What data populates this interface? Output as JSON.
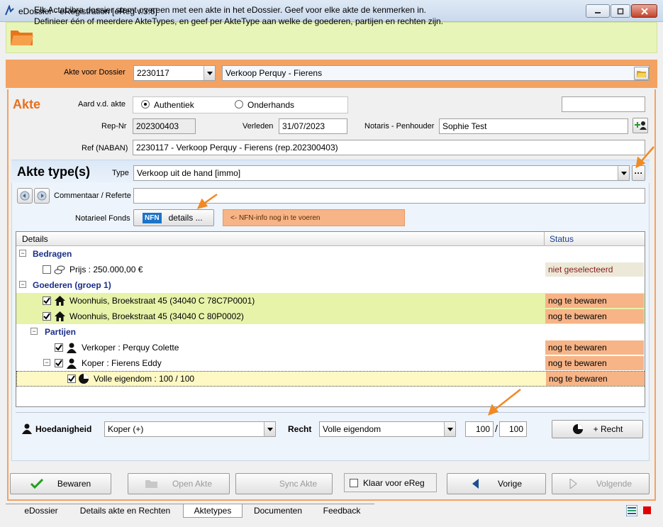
{
  "window": {
    "title": "eDossier - eRegistration [eReg v.3.6]"
  },
  "info": {
    "line1": "Elk ActaLibra dossier stemt overeen met een akte in het eDossier. Geef voor elke akte de kenmerken in.",
    "line2": "Definieer één of meerdere AkteTypes, en geef per AkteType aan welke de goederen, partijen en rechten zijn."
  },
  "dossier": {
    "label": "Akte voor Dossier",
    "number": "2230117",
    "name": "Verkoop Perquy - Fierens"
  },
  "akte": {
    "heading": "Akte",
    "aard_label": "Aard v.d. akte",
    "option_authentiek": "Authentiek",
    "option_onderhands": "Onderhands",
    "repnr_label": "Rep-Nr",
    "repnr_value": "202300403",
    "verleden_label": "Verleden",
    "verleden_value": "31/07/2023",
    "notaris_label": "Notaris - Penhouder",
    "notaris_value": "Sophie Test",
    "ref_label": "Ref (NABAN)",
    "ref_value": "2230117 - Verkoop Perquy - Fierens (rep.202300403)"
  },
  "types": {
    "heading": "Akte type(s)",
    "type_label": "Type",
    "type_value": "Verkoop uit de hand [immo]",
    "commentaar_label": "Commentaar / Referte",
    "fonds_label": "Notarieel Fonds",
    "nfn_badge": "NFN",
    "details_label": "details ...",
    "nfn_info": "<- NFN-info nog in te voeren"
  },
  "grid": {
    "col_details": "Details",
    "col_status": "Status",
    "rows": [
      {
        "text": "Bedragen",
        "status": ""
      },
      {
        "text": "Prijs : 250.000,00 €",
        "status": "niet geselecteerd"
      },
      {
        "text": "Goederen (groep 1)",
        "status": ""
      },
      {
        "text": "Woonhuis, Broekstraat 45 (34040 C 78C7P0001)",
        "status": "nog te bewaren"
      },
      {
        "text": "Woonhuis, Broekstraat 45 (34040 C 80P0002)",
        "status": "nog te bewaren"
      },
      {
        "text": "Partijen",
        "status": ""
      },
      {
        "text": "Verkoper : Perquy Colette",
        "status": "nog te bewaren"
      },
      {
        "text": "Koper : Fierens Eddy",
        "status": "nog te bewaren"
      },
      {
        "text": "Volle eigendom : 100 / 100",
        "status": "nog te bewaren"
      }
    ]
  },
  "bottom": {
    "hoedanigheid_label": "Hoedanigheid",
    "hoedanigheid_value": "Koper (+)",
    "recht_label": "Recht",
    "recht_value": "Volle eigendom",
    "share_num": "100",
    "share_den": "100",
    "add_recht_label": "+ Recht"
  },
  "actions": {
    "bewaren": "Bewaren",
    "open_akte": "Open Akte",
    "sync_akte": "Sync Akte",
    "klaar": "Klaar voor eReg",
    "vorige": "Vorige",
    "volgende": "Volgende"
  },
  "tabs": [
    "eDossier",
    "Details akte en Rechten",
    "Aktetypes",
    "Documenten",
    "Feedback"
  ],
  "colors": {
    "accent_orange": "#f4a262",
    "heading_orange": "#e8701c",
    "status_orange": "#f6b487",
    "highlight_green": "#e6f3a9",
    "arrow": "#f08a24"
  }
}
